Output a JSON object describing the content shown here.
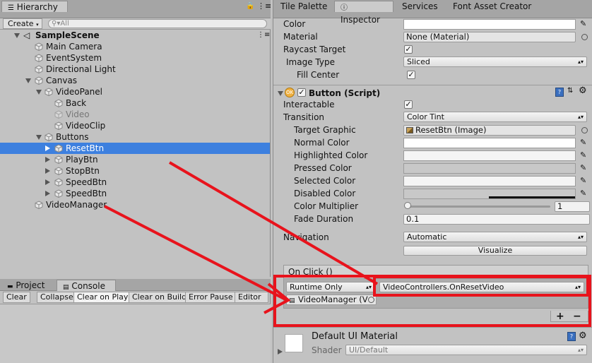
{
  "hierarchy": {
    "tab": "Hierarchy",
    "create_label": "Create",
    "search_placeholder": "All",
    "scene": "SampleScene",
    "items": [
      {
        "label": "Main Camera"
      },
      {
        "label": "EventSystem"
      },
      {
        "label": "Directional Light"
      },
      {
        "label": "Canvas"
      },
      {
        "label": "VideoPanel"
      },
      {
        "label": "Back"
      },
      {
        "label": "Video"
      },
      {
        "label": "VideoClip"
      },
      {
        "label": "Buttons"
      },
      {
        "label": "ResetBtn"
      },
      {
        "label": "PlayBtn"
      },
      {
        "label": "StopBtn"
      },
      {
        "label": "SpeedBtn"
      },
      {
        "label": "SpeedBtn"
      },
      {
        "label": "VideoManager"
      }
    ]
  },
  "console": {
    "tabs": [
      "Project",
      "Console"
    ],
    "buttons": [
      "Clear",
      "Collapse",
      "Clear on Play",
      "Clear on Build",
      "Error Pause",
      "Editor"
    ]
  },
  "inspector": {
    "tabs": [
      "Tile Palette",
      "Inspector",
      "Services",
      "Font Asset Creator"
    ],
    "image": {
      "color_label": "Color",
      "material_label": "Material",
      "material_value": "None (Material)",
      "raycast_label": "Raycast Target",
      "image_type_label": "Image Type",
      "image_type_value": "Sliced",
      "fill_center_label": "Fill Center"
    },
    "button": {
      "title": "Button (Script)",
      "interactable_label": "Interactable",
      "transition_label": "Transition",
      "transition_value": "Color Tint",
      "target_graphic_label": "Target Graphic",
      "target_graphic_value": "ResetBtn (Image)",
      "normal_color_label": "Normal Color",
      "highlighted_color_label": "Highlighted Color",
      "pressed_color_label": "Pressed Color",
      "selected_color_label": "Selected Color",
      "disabled_color_label": "Disabled Color",
      "color_multiplier_label": "Color Multiplier",
      "color_multiplier_value": "1",
      "color_multiplier_fraction": 0.0,
      "fade_duration_label": "Fade Duration",
      "fade_duration_value": "0.1",
      "navigation_label": "Navigation",
      "navigation_value": "Automatic",
      "visualize_label": "Visualize"
    },
    "on_click": {
      "header": "On Click ()",
      "runtime_value": "Runtime Only",
      "function_value": "VideoControllers.OnResetVideo",
      "object_value": "VideoManager (V",
      "add": "+",
      "remove": "−"
    },
    "material": {
      "name": "Default UI Material",
      "shader_label": "Shader",
      "shader_value": "UI/Default"
    }
  },
  "colors": {
    "highlight": "#e8131c",
    "selection": "#3d80df"
  }
}
